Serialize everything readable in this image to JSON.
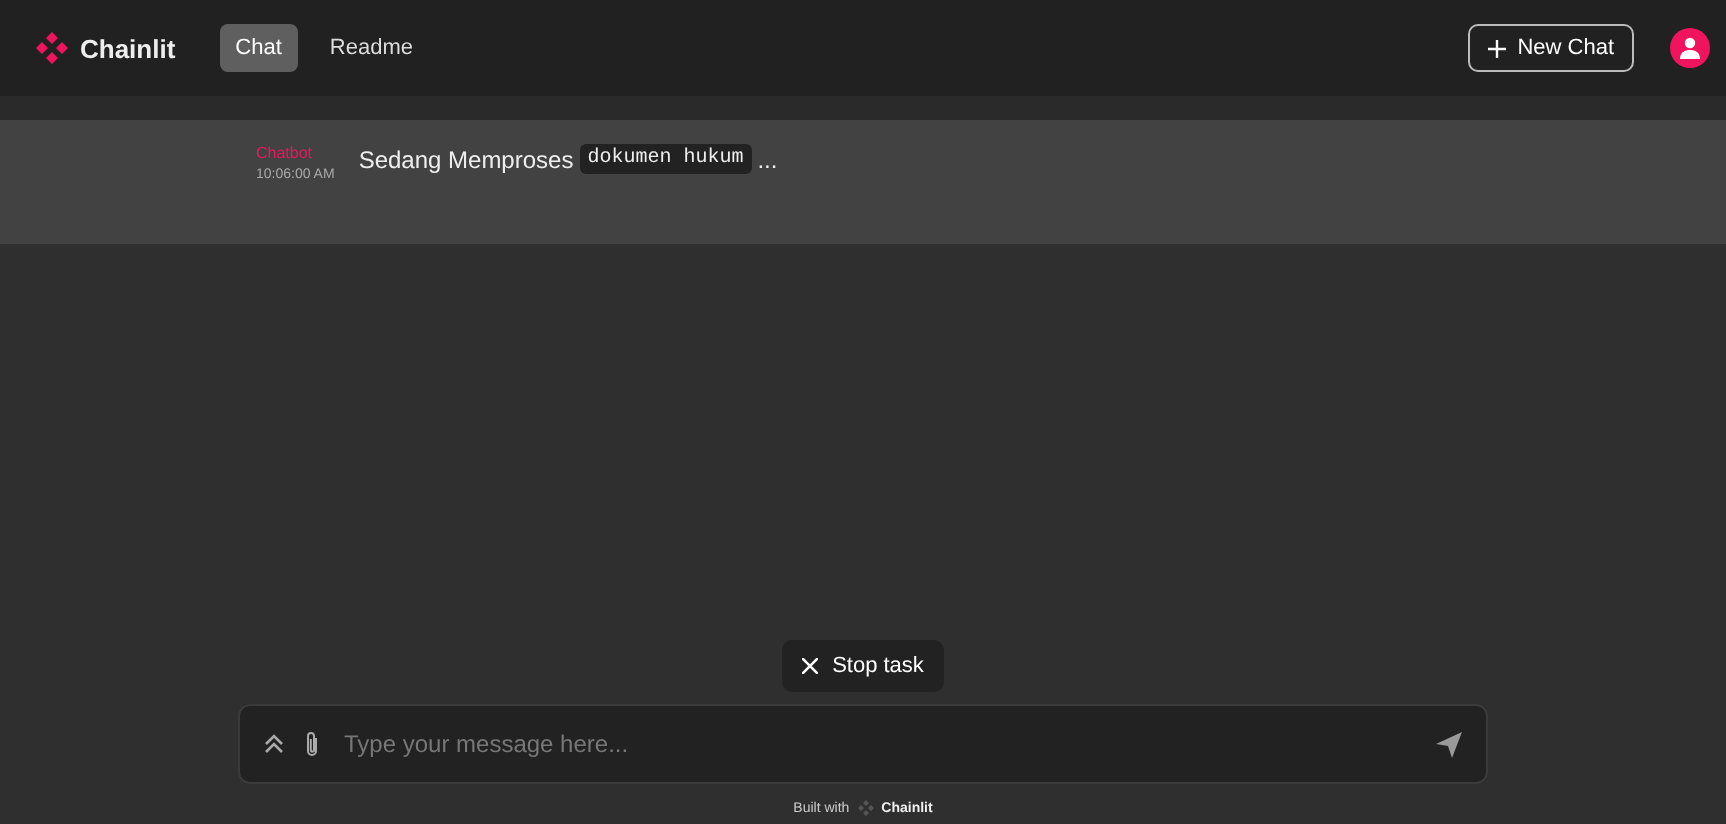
{
  "header": {
    "brand": "Chainlit",
    "tabs": [
      {
        "label": "Chat",
        "selected": true
      },
      {
        "label": "Readme",
        "selected": false
      }
    ],
    "new_chat": "New Chat"
  },
  "messages": [
    {
      "author": "Chatbot",
      "time": "10:06:00 AM",
      "text": "Sedang Memproses",
      "code": "dokumen hukum",
      "suffix": "..."
    }
  ],
  "stop_task": "Stop task",
  "composer": {
    "placeholder": "Type your message here..."
  },
  "footer": {
    "prefix": "Built with",
    "brand": "Chainlit"
  }
}
